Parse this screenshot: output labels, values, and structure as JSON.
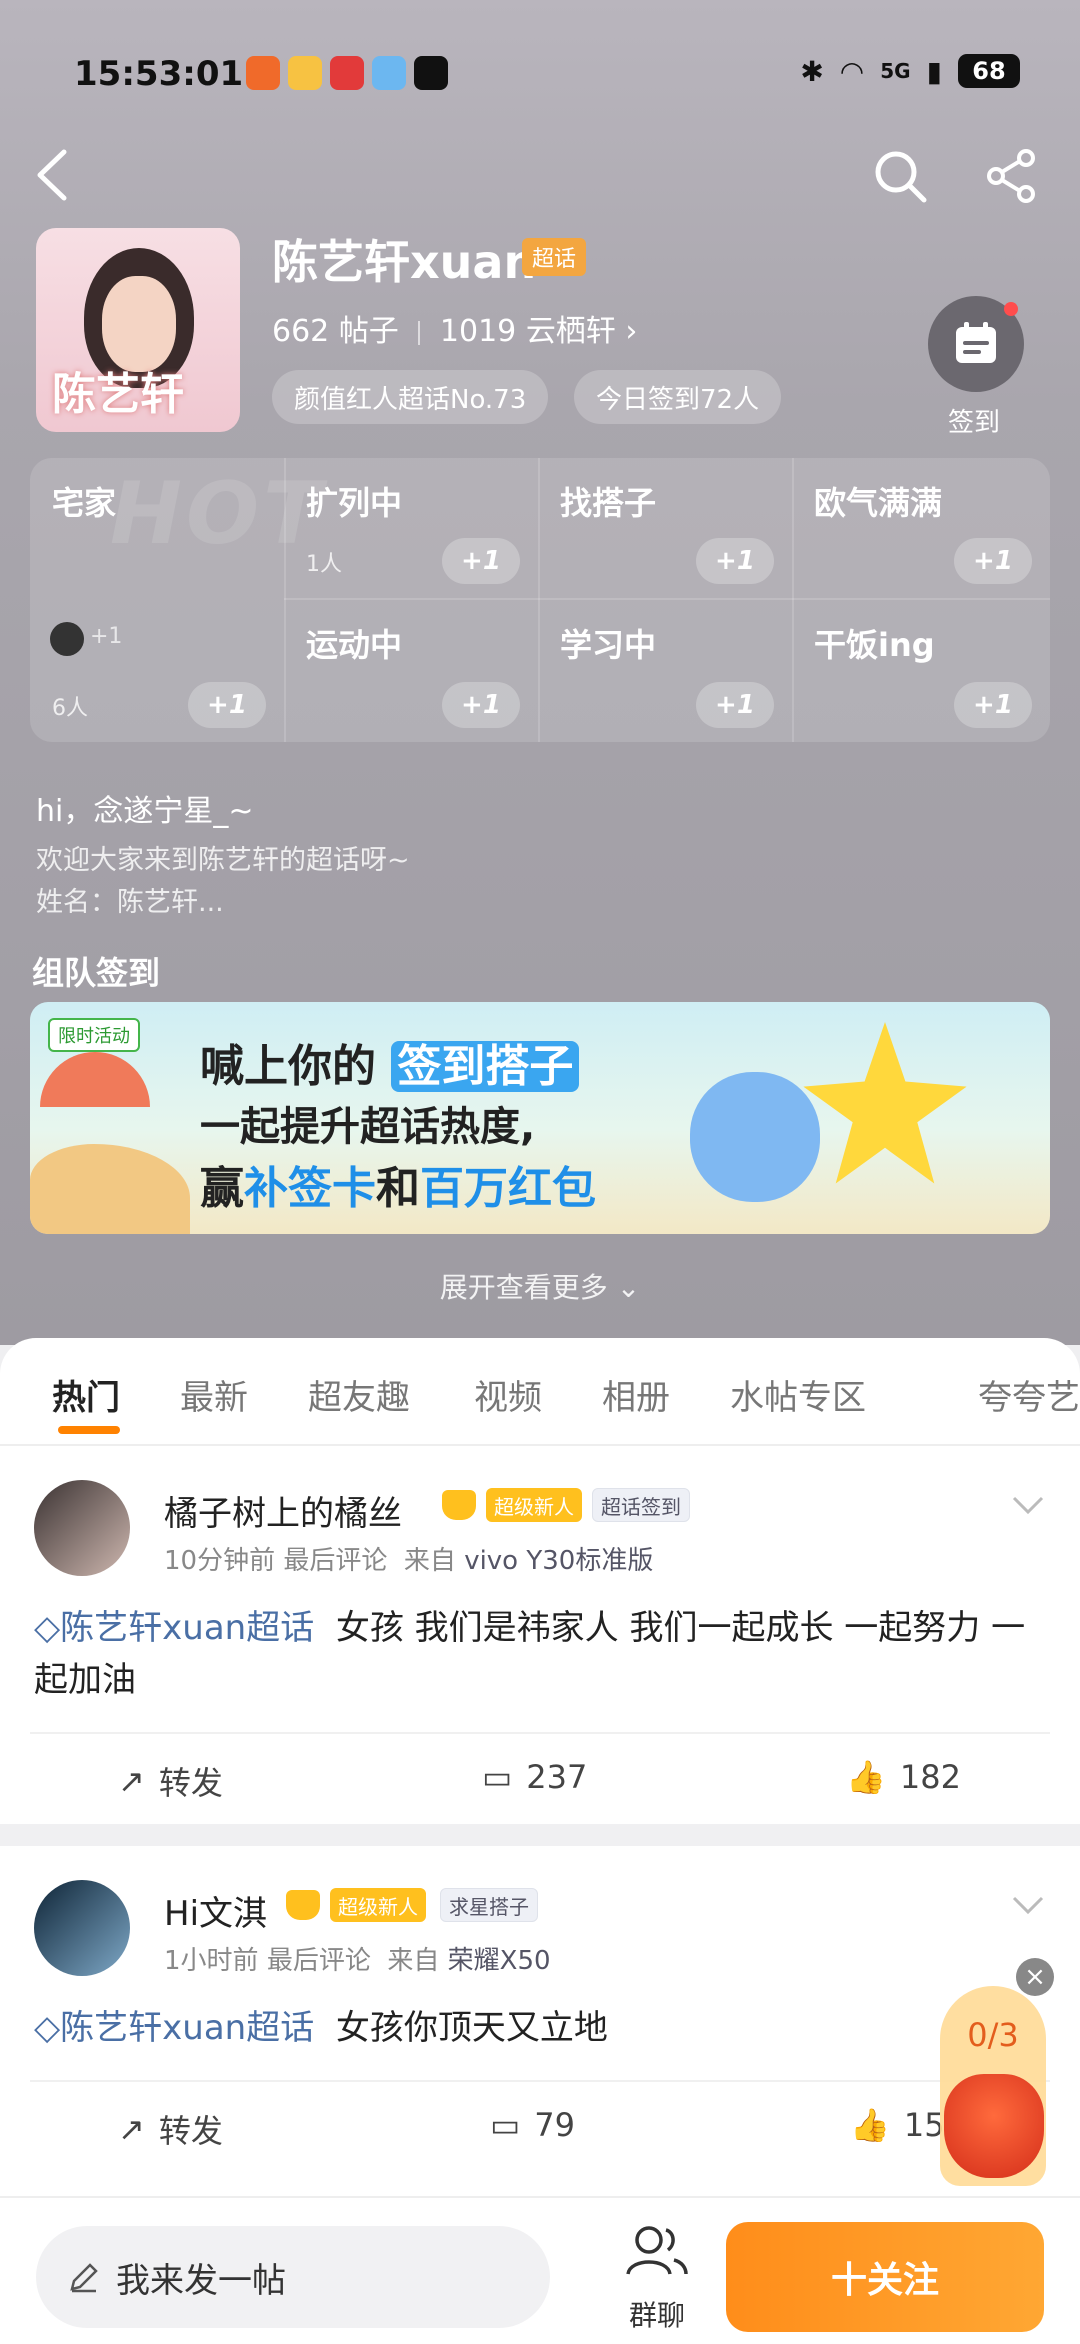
{
  "status_bar": {
    "time": "15:53:01",
    "signal": "5G",
    "battery": "68"
  },
  "header": {
    "title": "陈艺轩xuan",
    "badge": "超话",
    "posts_count": "662",
    "posts_label": "帖子",
    "followers_count": "1019",
    "followers_label": "云栖轩",
    "rank_pill": "颜值红人超话No.73",
    "checkin_pill": "今日签到72人",
    "signin_label": "签到",
    "avatar_text": "陈艺轩"
  },
  "status_grid": {
    "watermark": "HOT",
    "plus": "+1",
    "cells": [
      {
        "name": "宅家",
        "count": "6人"
      },
      {
        "name": "扩列中",
        "count": "1人"
      },
      {
        "name": "找搭子",
        "count": ""
      },
      {
        "name": "欧气满满",
        "count": ""
      },
      {
        "name": "运动中",
        "count": ""
      },
      {
        "name": "学习中",
        "count": ""
      },
      {
        "name": "干饭ing",
        "count": ""
      }
    ],
    "mini_plus": "+1"
  },
  "intro": {
    "greeting": "hi，念遂宁星_~",
    "line1": "欢迎大家来到陈艺轩的超话呀~",
    "line2": "姓名：陈艺轩..."
  },
  "team": {
    "title": "组队签到",
    "banner_tag": "限时活动",
    "banner_line1_a": "喊上你的",
    "banner_line1_b": "签到搭子",
    "banner_line2": "一起提升超话热度,",
    "banner_line3_a": "赢",
    "banner_line3_b": "补签卡",
    "banner_line3_c": "和",
    "banner_line3_d": "百万红包"
  },
  "expand_more": "展开查看更多",
  "tabs": [
    "热门",
    "最新",
    "超友趣",
    "视频",
    "相册",
    "水帖专区",
    "夸夸艺"
  ],
  "posts": [
    {
      "user": "橘子树上的橘丝",
      "badge1": "超级新人",
      "badge2": "超话签到",
      "time": "10分钟前",
      "last_comment": "最后评论",
      "from": "来自",
      "device": "vivo Y30标准版",
      "topic": "陈艺轩xuan超话",
      "text": "女孩 我们是祎家人 我们一起成长 一起努力 一起加油",
      "repost": "转发",
      "comments": "237",
      "likes": "182"
    },
    {
      "user": "Hi文淇",
      "badge1": "超级新人",
      "badge2": "求星搭子",
      "time": "1小时前",
      "last_comment": "最后评论",
      "from": "来自",
      "device": "荣耀X50",
      "topic": "陈艺轩xuan超话",
      "text": "女孩你顶天又立地",
      "repost": "转发",
      "comments": "79",
      "likes": "15"
    }
  ],
  "floating": {
    "progress": "0/3"
  },
  "bottom_bar": {
    "compose": "我来发一帖",
    "group": "群聊",
    "follow": "十关注"
  }
}
